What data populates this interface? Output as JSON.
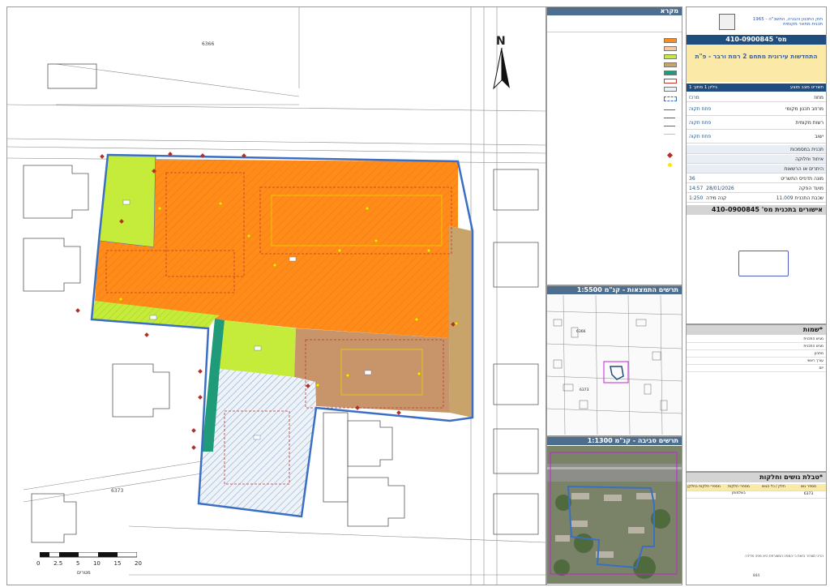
{
  "map": {
    "north_label": "N",
    "scale_ticks": [
      "0",
      "2.5",
      "5",
      "10",
      "15",
      "20"
    ],
    "scale_units": "מטרים",
    "parcel_number_top": "6366",
    "parcel_number_bottom": "6373",
    "street_label": "Ⓐ",
    "colors": {
      "orange": "#ff8c1a",
      "lime": "#c5ec3a",
      "brown": "#c8956b",
      "tan": "#c9a46a",
      "teal": "#1f9b7a",
      "hatch_blue": "#b8cbe0",
      "blue_border": "#3a6fc4"
    }
  },
  "legend": {
    "title": "מקרא",
    "rows": [
      "",
      "",
      "",
      "",
      "",
      "",
      "",
      "",
      "",
      "",
      "",
      "",
      "",
      "",
      "",
      "",
      "",
      "",
      "",
      "",
      "",
      ""
    ]
  },
  "plan_panel": {
    "header_lines": [
      "חוק התכנון והבניה, התשכ\"ה - 1965",
      "תכנית מתאר מקומית"
    ],
    "plan_number": "מס' 410-0900845",
    "plan_title": "התחדשות עירונית מתחם 2 רמת ורבר - פ\"ת",
    "sub_header_left": "גיליון 1 מתוך 1",
    "sub_header_right": "תשריט מצב מוצע",
    "rows": [
      {
        "label": "מחוז",
        "value": "מרכז"
      },
      {
        "label": "מרחב תכנון מקומי",
        "value": "פתח תקוה"
      },
      {
        "label": "רשות מקומית",
        "value": "פתח תקוה"
      },
      {
        "label": "ישוב",
        "value": "פתח תקוה"
      }
    ],
    "lower_rows": [
      {
        "label": "תכנית במסמכות",
        "value": ""
      },
      {
        "label": "איחוד וחלוקה",
        "value": ""
      },
      {
        "label": "היתרים או הרשאות",
        "value": ""
      }
    ],
    "version_label": "מונה תדפיס התשריט",
    "version_value": "36",
    "deadline_label": "מועד הפקה",
    "date": "28/01/2026",
    "time": "14:57",
    "layer_label": "שכבת התכנית",
    "layer_value": "11.009",
    "scale_label": "קנה מידה",
    "scale_value": "1:250",
    "approvals_title": "אישורים בתכנית מס' 410-0900845",
    "names_title": "שמות*",
    "names_rows": [
      "מגיש התכנית",
      "מגיש התכנית",
      "מתכנן",
      "עורך ראשי",
      "יזם"
    ],
    "parcels_title": "טבלת גושים וחלקות*",
    "parcels_head": [
      "מספר גוש",
      "חלק / כל הגוש",
      "מספרי חלקות בשלמותן",
      "מספרי חלקות בחלקן"
    ],
    "parcels_row": [
      "6373",
      "",
      "",
      ""
    ],
    "footer_notes": [
      "הריני מצהיר בזאת כי המפה המצורפת היא מפה מדידה",
      "",
      "",
      "",
      "",
      "",
      "844"
    ]
  },
  "insets": {
    "results_title": "תרשים התמצאות - קנ\"מ 1:5500",
    "surroundings_title": "תרשים סביבה - קנ\"מ 1:1300",
    "results_parcel_top": "6366",
    "results_parcel_bottom": "6373"
  }
}
